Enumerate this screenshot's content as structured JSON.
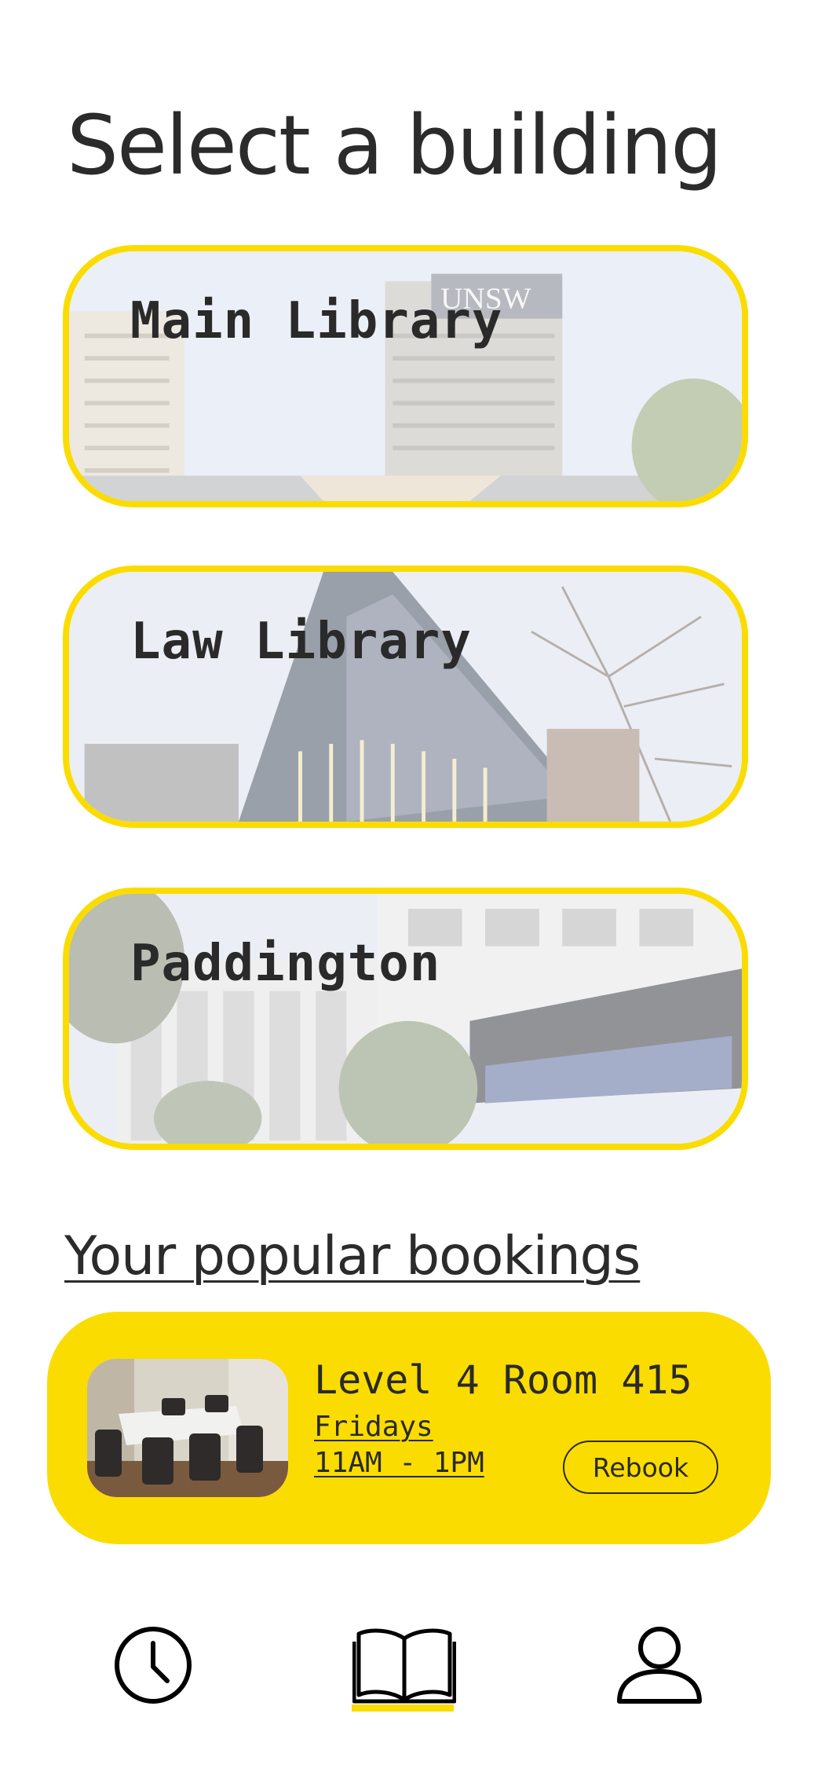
{
  "page": {
    "title": "Select a building"
  },
  "buildings": [
    {
      "name": "Main Library",
      "sign_text": "UNSW"
    },
    {
      "name": "Law Library"
    },
    {
      "name": "Paddington"
    }
  ],
  "popular": {
    "heading": "Your popular bookings",
    "bookings": [
      {
        "room": "Level 4 Room 415",
        "day": "Fridays",
        "time": "11AM - 1PM",
        "action_label": "Rebook"
      }
    ]
  },
  "nav": {
    "items": [
      {
        "icon": "clock-icon",
        "key": "history"
      },
      {
        "icon": "book-open-icon",
        "key": "book",
        "active": true
      },
      {
        "icon": "user-icon",
        "key": "profile"
      }
    ]
  },
  "colors": {
    "accent": "#fadc00",
    "text": "#2a2a2a",
    "background": "#ffffff"
  }
}
